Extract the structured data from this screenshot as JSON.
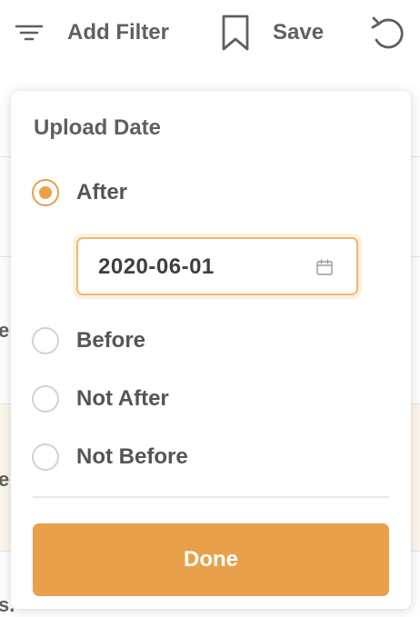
{
  "toolbar": {
    "add_filter_label": "Add Filter",
    "save_label": "Save",
    "icons": {
      "filter": "filter-lines-icon",
      "save": "bookmark-icon",
      "reset": "refresh-icon"
    }
  },
  "background": {
    "edge_text_1": "e",
    "edge_text_2": "e",
    "edge_text_3": "s."
  },
  "popover": {
    "title": "Upload Date",
    "options": [
      {
        "label": "After",
        "checked": true
      },
      {
        "label": "Before",
        "checked": false
      },
      {
        "label": "Not After",
        "checked": false
      },
      {
        "label": "Not Before",
        "checked": false
      }
    ],
    "date_value": "2020-06-01",
    "date_icon": "calendar-icon",
    "done_label": "Done"
  },
  "colors": {
    "accent": "#e8a04a",
    "text": "#555555",
    "input_border": "#f0b870"
  }
}
